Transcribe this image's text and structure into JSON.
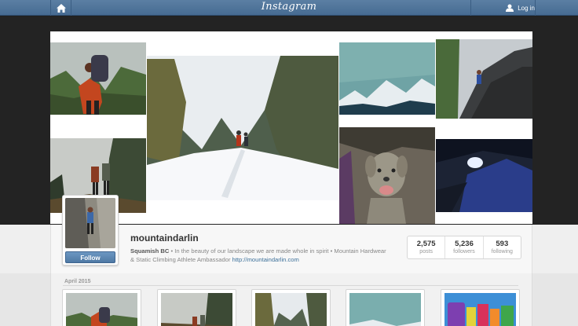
{
  "header": {
    "logo": "Instagram",
    "login_label": "Log in",
    "home_icon": "home-icon",
    "user_icon": "user-icon"
  },
  "profile": {
    "username": "mountaindarlin",
    "location": "Squamish BC",
    "bio": " • In the beauty of our landscape we are made whole in spirit • Mountain Hardwear & Static Climbing Athlete Ambassador ",
    "link": "http://mountaindarlin.com",
    "follow_label": "Follow",
    "stats": [
      {
        "value": "2,575",
        "label": "posts"
      },
      {
        "value": "5,236",
        "label": "followers"
      },
      {
        "value": "593",
        "label": "following"
      }
    ]
  },
  "feed": {
    "month_label": "April 2015"
  },
  "colors": {
    "header_blue": "#517fa4",
    "follow_blue": "#5b87b3",
    "link_blue": "#3f729b"
  }
}
